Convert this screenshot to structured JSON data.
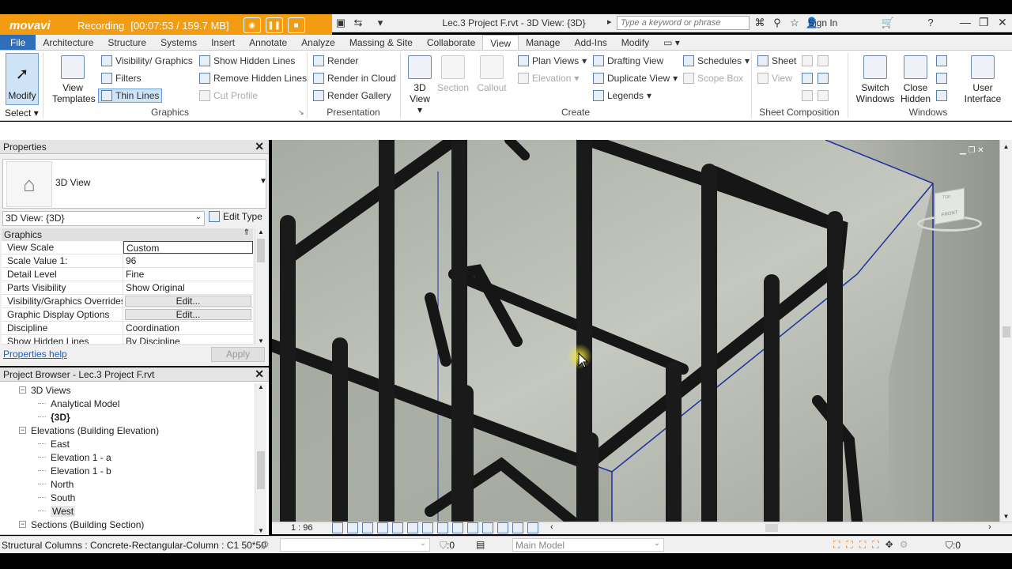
{
  "recorder": {
    "logo": "movavi",
    "status": "Recording",
    "info": "[00:07:53 / 159.7 MB]"
  },
  "titlebar": {
    "document_title": "Lec.3 Project F.rvt - 3D View: {3D}",
    "search_placeholder": "Type a keyword or phrase",
    "sign_in": "Sign In"
  },
  "tabs": [
    "File",
    "Architecture",
    "Structure",
    "Systems",
    "Insert",
    "Annotate",
    "Analyze",
    "Massing & Site",
    "Collaborate",
    "View",
    "Manage",
    "Add-Ins",
    "Modify"
  ],
  "active_tab": "View",
  "ribbon": {
    "modify": "Modify",
    "select": "Select",
    "view_templates": [
      "View",
      "Templates"
    ],
    "graphics": {
      "visibility_graphics": "Visibility/ Graphics",
      "filters": "Filters",
      "thin_lines": "Thin Lines",
      "show_hidden_lines": "Show  Hidden Lines",
      "remove_hidden_lines": "Remove  Hidden Lines",
      "cut_profile": "Cut  Profile",
      "label": "Graphics"
    },
    "presentation": {
      "render": "Render",
      "render_in_cloud": "Render  in Cloud",
      "render_gallery": "Render  Gallery",
      "label": "Presentation"
    },
    "create": {
      "view_3d": [
        "3D",
        "View"
      ],
      "section": "Section",
      "callout": "Callout",
      "plan_views": "Plan  Views",
      "elevation": "Elevation",
      "drafting_view": "Drafting  View",
      "duplicate_view": "Duplicate  View",
      "legends": "Legends",
      "schedules": "Schedules",
      "scope_box": "Scope  Box",
      "label": "Create"
    },
    "sheet_composition": {
      "sheet": "Sheet",
      "view": "View",
      "label": "Sheet Composition"
    },
    "windows": {
      "switch_windows": [
        "Switch",
        "Windows"
      ],
      "close_hidden": [
        "Close",
        "Hidden"
      ],
      "user_interface": [
        "User",
        "Interface"
      ],
      "label": "Windows"
    }
  },
  "properties": {
    "title": "Properties",
    "type_name": "3D View",
    "view_dropdown": "3D View: {3D}",
    "edit_type": "Edit Type",
    "group": "Graphics",
    "rows": [
      {
        "key": "View Scale",
        "value": "Custom"
      },
      {
        "key": "Scale Value    1:",
        "value": "96"
      },
      {
        "key": "Detail Level",
        "value": "Fine"
      },
      {
        "key": "Parts Visibility",
        "value": "Show Original"
      },
      {
        "key": "Visibility/Graphics Overrides",
        "value": "Edit..."
      },
      {
        "key": "Graphic Display Options",
        "value": "Edit..."
      },
      {
        "key": "Discipline",
        "value": "Coordination"
      },
      {
        "key": "Show Hidden Lines",
        "value": "By Discipline"
      }
    ],
    "help": "Properties help",
    "apply": "Apply"
  },
  "browser": {
    "title": "Project Browser - Lec.3 Project F.rvt",
    "items": [
      {
        "label": "3D Views",
        "level": 1,
        "toggle": "−"
      },
      {
        "label": "Analytical Model",
        "level": 2
      },
      {
        "label": "{3D}",
        "level": 2,
        "bold": true
      },
      {
        "label": "Elevations (Building Elevation)",
        "level": 1,
        "toggle": "−"
      },
      {
        "label": "East",
        "level": 2
      },
      {
        "label": "Elevation 1 - a",
        "level": 2
      },
      {
        "label": "Elevation 1 - b",
        "level": 2
      },
      {
        "label": "North",
        "level": 2
      },
      {
        "label": "South",
        "level": 2
      },
      {
        "label": "West",
        "level": 2,
        "selected": true
      },
      {
        "label": "Sections (Building Section)",
        "level": 1,
        "toggle": "−"
      }
    ]
  },
  "viewport": {
    "scale": "1 : 96",
    "viewcube_front": "FRONT",
    "viewcube_top": "TOP"
  },
  "statusbar": {
    "message": "Structural Columns : Concrete-Rectangular-Column : C1 50*50",
    "counter": ":0",
    "model": "Main Model",
    "filter_count": ":0"
  }
}
